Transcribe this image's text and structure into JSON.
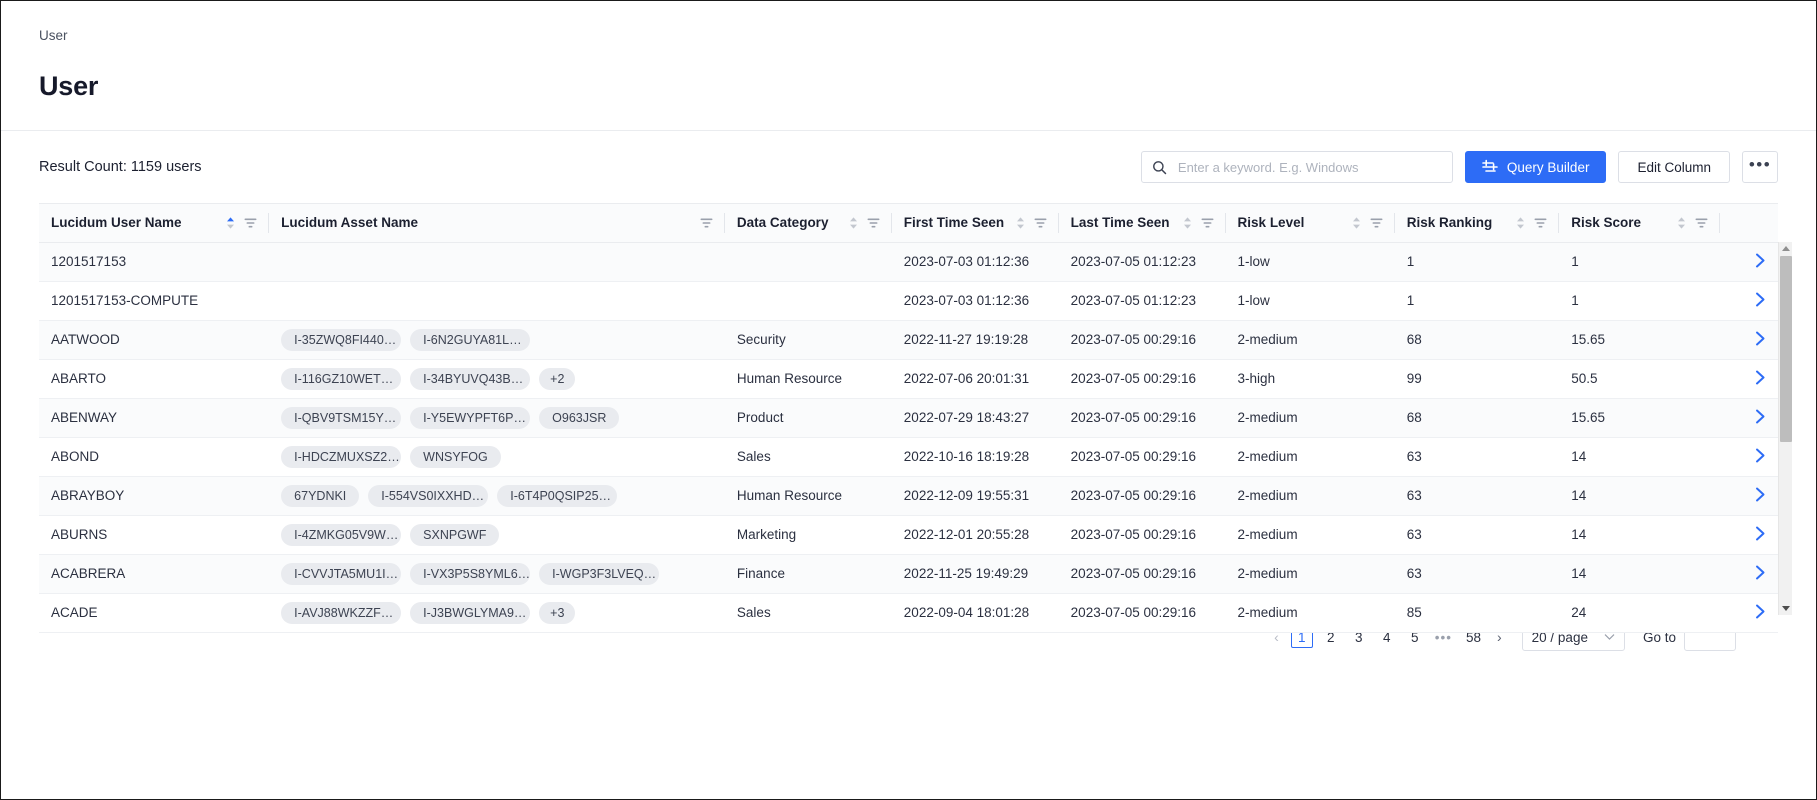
{
  "breadcrumb": "User",
  "page_title": "User",
  "toolbar": {
    "result_count": "Result Count: 1159 users",
    "search_placeholder": "Enter a keyword. E.g. Windows",
    "search_value": "",
    "query_builder_label": "Query Builder",
    "edit_column_label": "Edit Column",
    "more_label": "•••"
  },
  "colors": {
    "accent": "#2d6cf6",
    "tag_bg": "#e9ebef",
    "header_bg": "#fafbfc",
    "border": "#eaecef"
  },
  "table": {
    "columns": [
      {
        "label": "Lucidum User Name",
        "sortable": true,
        "filterable": true,
        "sorted": "asc"
      },
      {
        "label": "Lucidum Asset Name",
        "sortable": false,
        "filterable": true,
        "sorted": "none"
      },
      {
        "label": "Data Category",
        "sortable": true,
        "filterable": true,
        "sorted": "none"
      },
      {
        "label": "First Time Seen",
        "sortable": true,
        "filterable": true,
        "sorted": "none"
      },
      {
        "label": "Last Time Seen",
        "sortable": true,
        "filterable": true,
        "sorted": "none"
      },
      {
        "label": "Risk Level",
        "sortable": true,
        "filterable": true,
        "sorted": "none"
      },
      {
        "label": "Risk Ranking",
        "sortable": true,
        "filterable": true,
        "sorted": "none"
      },
      {
        "label": "Risk Score",
        "sortable": true,
        "filterable": true,
        "sorted": "none"
      }
    ],
    "rows": [
      {
        "user": "1201517153",
        "assets": [],
        "category": "",
        "first_seen": "2023-07-03 01:12:36",
        "last_seen": "2023-07-05 01:12:23",
        "risk_level": "1-low",
        "risk_ranking": "1",
        "risk_score": "1"
      },
      {
        "user": "1201517153-COMPUTE",
        "assets": [],
        "category": "",
        "first_seen": "2023-07-03 01:12:36",
        "last_seen": "2023-07-05 01:12:23",
        "risk_level": "1-low",
        "risk_ranking": "1",
        "risk_score": "1"
      },
      {
        "user": "AATWOOD",
        "assets": [
          "I-35ZWQ8FI440…",
          "I-6N2GUYA81L…"
        ],
        "category": "Security",
        "first_seen": "2022-11-27 19:19:28",
        "last_seen": "2023-07-05 00:29:16",
        "risk_level": "2-medium",
        "risk_ranking": "68",
        "risk_score": "15.65"
      },
      {
        "user": "ABARTO",
        "assets": [
          "I-116GZ10WET…",
          "I-34BYUVQ43B…",
          "+2"
        ],
        "category": "Human Resource",
        "first_seen": "2022-07-06 20:01:31",
        "last_seen": "2023-07-05 00:29:16",
        "risk_level": "3-high",
        "risk_ranking": "99",
        "risk_score": "50.5"
      },
      {
        "user": "ABENWAY",
        "assets": [
          "I-QBV9TSM15Y…",
          "I-Y5EWYPFT6P…",
          "O963JSR"
        ],
        "category": "Product",
        "first_seen": "2022-07-29 18:43:27",
        "last_seen": "2023-07-05 00:29:16",
        "risk_level": "2-medium",
        "risk_ranking": "68",
        "risk_score": "15.65"
      },
      {
        "user": "ABOND",
        "assets": [
          "I-HDCZMUXSZ2…",
          "WNSYFOG"
        ],
        "category": "Sales",
        "first_seen": "2022-10-16 18:19:28",
        "last_seen": "2023-07-05 00:29:16",
        "risk_level": "2-medium",
        "risk_ranking": "63",
        "risk_score": "14"
      },
      {
        "user": "ABRAYBOY",
        "assets": [
          "67YDNKI",
          "I-554VS0IXXHD…",
          "I-6T4P0QSIP25…"
        ],
        "category": "Human Resource",
        "first_seen": "2022-12-09 19:55:31",
        "last_seen": "2023-07-05 00:29:16",
        "risk_level": "2-medium",
        "risk_ranking": "63",
        "risk_score": "14"
      },
      {
        "user": "ABURNS",
        "assets": [
          "I-4ZMKG05V9W…",
          "SXNPGWF"
        ],
        "category": "Marketing",
        "first_seen": "2022-12-01 20:55:28",
        "last_seen": "2023-07-05 00:29:16",
        "risk_level": "2-medium",
        "risk_ranking": "63",
        "risk_score": "14"
      },
      {
        "user": "ACABRERA",
        "assets": [
          "I-CVVJTA5MU1I…",
          "I-VX3P5S8YML6…",
          "I-WGP3F3LVEQ…"
        ],
        "category": "Finance",
        "first_seen": "2022-11-25 19:49:29",
        "last_seen": "2023-07-05 00:29:16",
        "risk_level": "2-medium",
        "risk_ranking": "63",
        "risk_score": "14"
      },
      {
        "user": "ACADE",
        "assets": [
          "I-AVJ88WKZZF…",
          "I-J3BWGLYMA9…",
          "+3"
        ],
        "category": "Sales",
        "first_seen": "2022-09-04 18:01:28",
        "last_seen": "2023-07-05 00:29:16",
        "risk_level": "2-medium",
        "risk_ranking": "85",
        "risk_score": "24"
      }
    ]
  },
  "pagination": {
    "prev": "‹",
    "next": "›",
    "pages": [
      "1",
      "2",
      "3",
      "4",
      "5"
    ],
    "ellipsis": "•••",
    "last_page": "58",
    "current_page": "1",
    "page_size": "20 / page",
    "goto_label": "Go to",
    "goto_value": ""
  }
}
